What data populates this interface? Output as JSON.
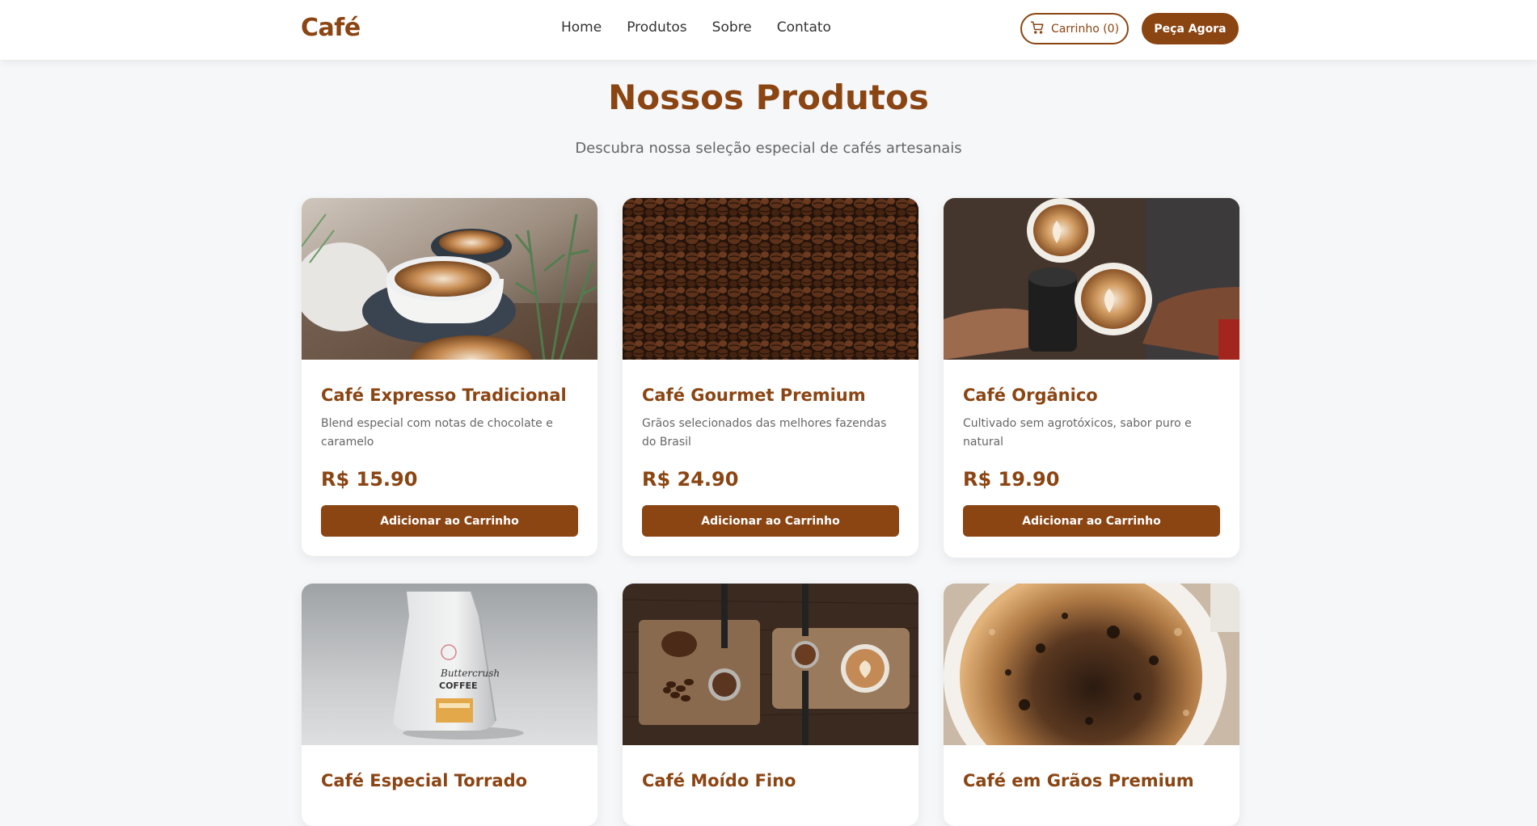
{
  "header": {
    "logo": "Café",
    "nav": [
      "Home",
      "Produtos",
      "Sobre",
      "Contato"
    ],
    "cart_label": "Carrinho (0)",
    "order_label": "Peça Agora"
  },
  "section": {
    "title": "Nossos Produtos",
    "subtitle": "Descubra nossa seleção especial de cafés artesanais"
  },
  "products": [
    {
      "name": "Café Expresso Tradicional",
      "desc": "Blend especial com notas de chocolate e caramelo",
      "price": "R$ 15.90",
      "button": "Adicionar ao Carrinho",
      "image": "latte-cups-photo"
    },
    {
      "name": "Café Gourmet Premium",
      "desc": "Grãos selecionados das melhores fazendas do Brasil",
      "price": "R$ 24.90",
      "button": "Adicionar ao Carrinho",
      "image": "coffee-beans-photo"
    },
    {
      "name": "Café Orgânico",
      "desc": "Cultivado sem agrotóxicos, sabor puro e natural",
      "price": "R$ 19.90",
      "button": "Adicionar ao Carrinho",
      "image": "hands-toasting-coffee-photo"
    },
    {
      "name": "Café Especial Torrado",
      "image": "coffee-bag-photo"
    },
    {
      "name": "Café Moído Fino",
      "image": "ground-coffee-board-photo"
    },
    {
      "name": "Café em Grãos Premium",
      "image": "coffee-cup-foam-photo"
    }
  ],
  "colors": {
    "brand": "#8b4513",
    "page_bg": "#f6f7f9",
    "card_bg": "#ffffff",
    "muted_text": "#666666"
  },
  "icons": {
    "cart": "cart-icon"
  }
}
